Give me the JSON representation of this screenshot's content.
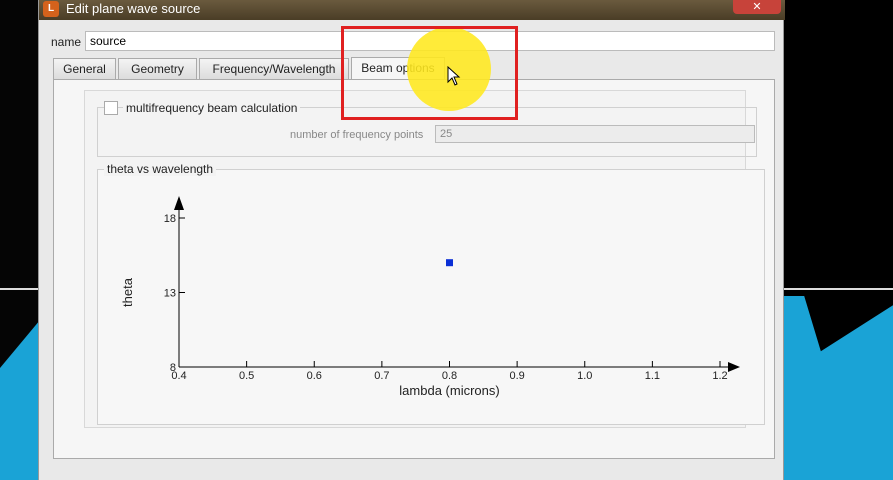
{
  "window": {
    "title": "Edit plane wave source",
    "close_symbol": "✕"
  },
  "name": {
    "label": "name",
    "value": "source"
  },
  "tabs": [
    {
      "label": "General",
      "active": false
    },
    {
      "label": "Geometry",
      "active": false
    },
    {
      "label": "Frequency/Wavelength",
      "active": false
    },
    {
      "label": "Beam options",
      "active": true
    }
  ],
  "beam": {
    "multifrequency_label": "multifrequency beam calculation",
    "multifrequency_checked": false,
    "freq_points_label": "number of frequency points",
    "freq_points_value": "25"
  },
  "chart_data": {
    "type": "scatter",
    "title": "theta vs wavelength",
    "xlabel": "lambda (microns)",
    "ylabel": "theta",
    "xlim": [
      0.4,
      1.2
    ],
    "ylim": [
      8,
      18
    ],
    "xticks": [
      "0.4",
      "0.5",
      "0.6",
      "0.7",
      "0.8",
      "0.9",
      "1.0",
      "1.1",
      "1.2"
    ],
    "yticks": [
      "8",
      "13",
      "18"
    ],
    "points": [
      {
        "x": 0.8,
        "y": 15
      }
    ],
    "point_color": "#0a2fd6"
  }
}
